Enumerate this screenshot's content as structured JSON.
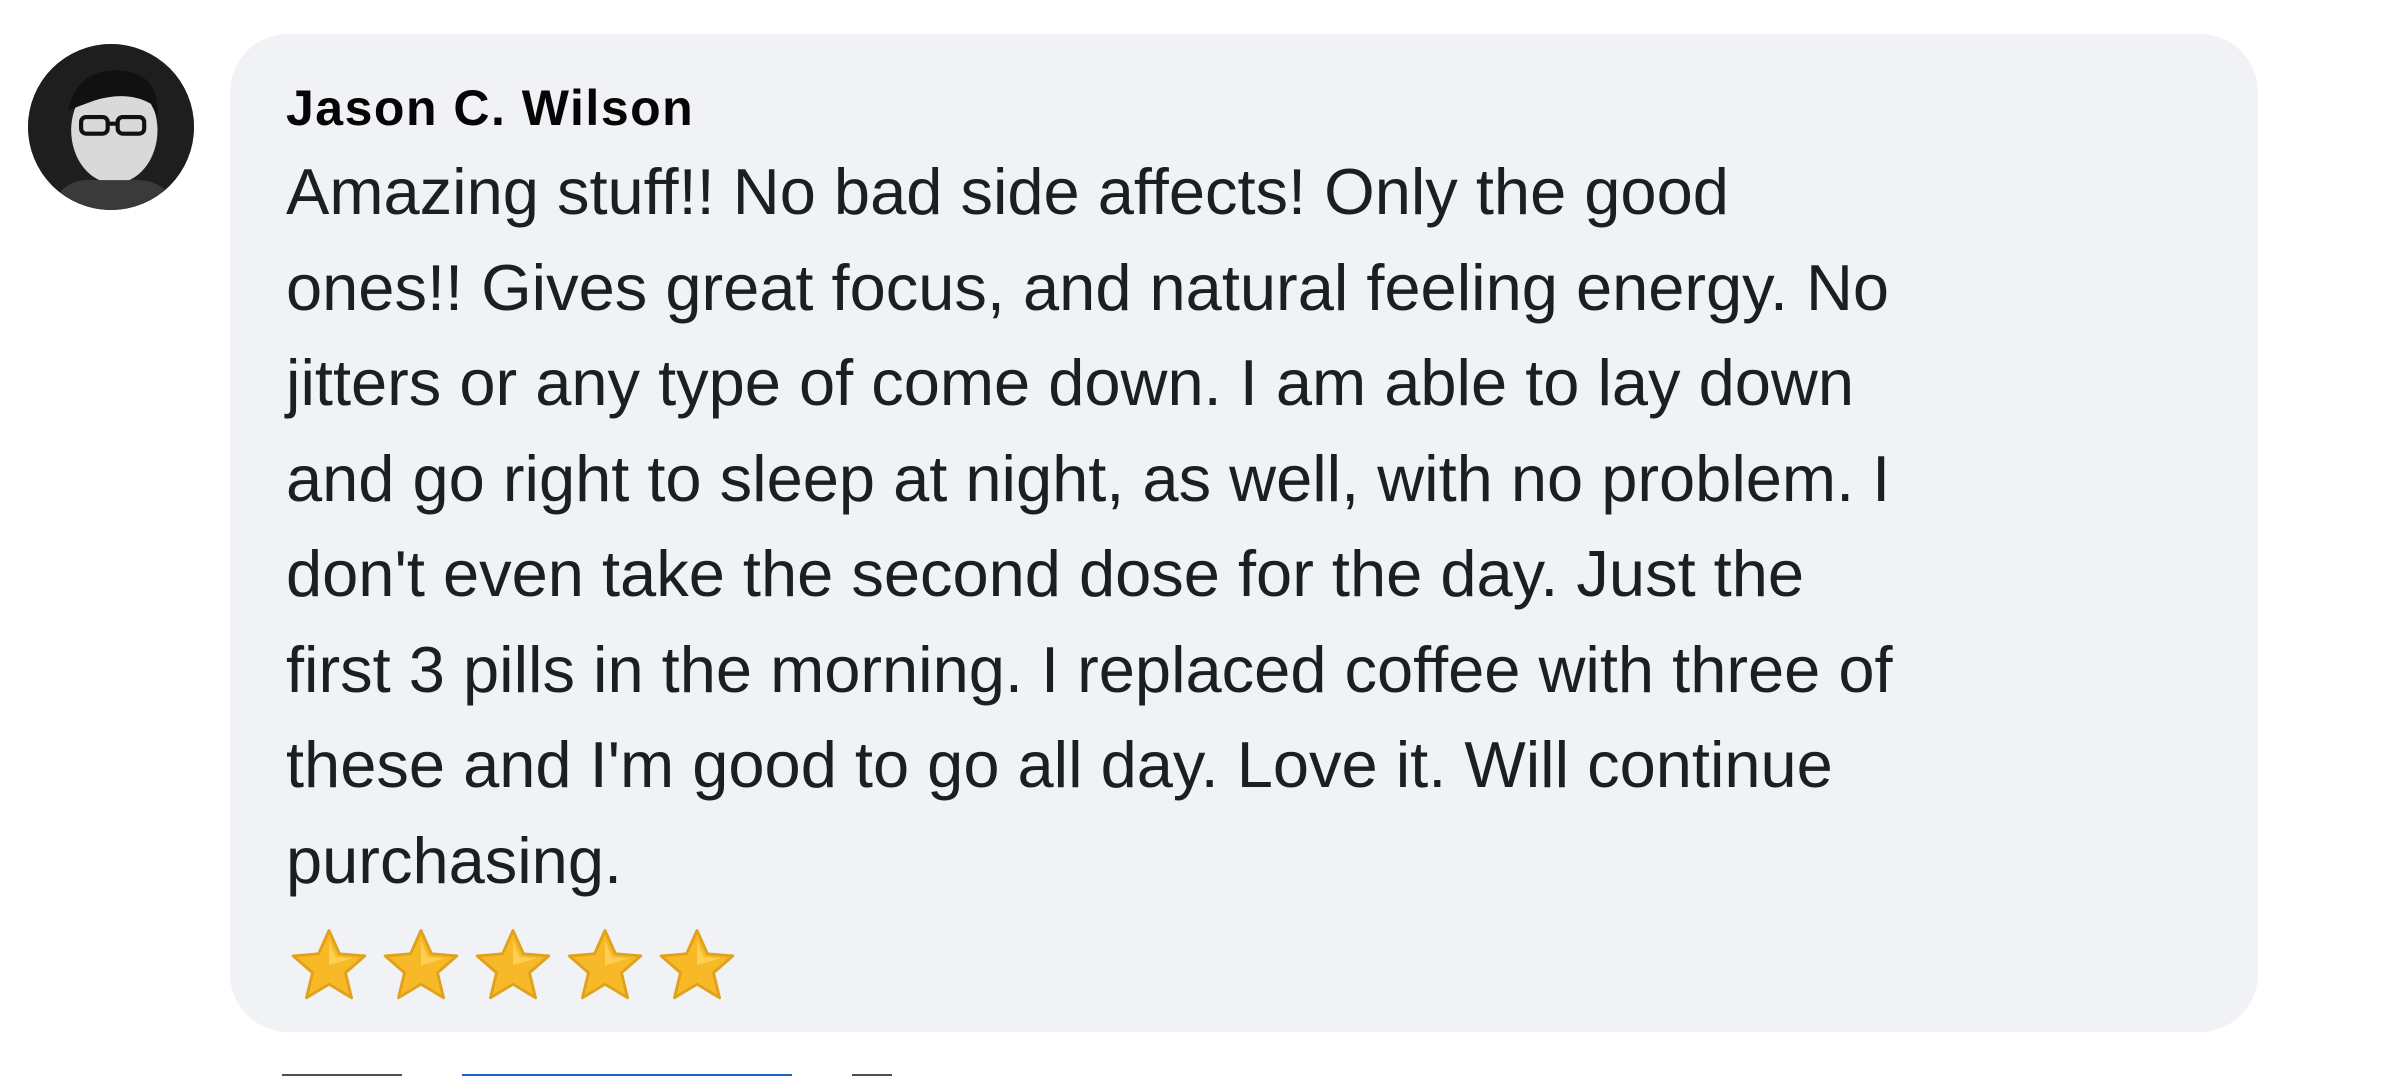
{
  "comment": {
    "author": "Jason C. Wilson",
    "lines": [
      "Amazing stuff!! No bad side affects! Only the good",
      "ones!! Gives great focus, and natural feeling energy. No",
      "jitters or any type of come down. I am able to lay down",
      "and go right to sleep at night, as well, with no problem. I",
      "don't even take the second dose for the day. Just the",
      "first 3 pills in the morning. I replaced coffee with three of",
      "these and I'm good to go all day. Love it. Will continue",
      "purchasing."
    ],
    "rating": {
      "stars": 5,
      "star_icon": "star-emoji-icon",
      "star_color": "#f7b928"
    }
  },
  "colors": {
    "bubble_bg": "#f0f2f5",
    "author": "#050505",
    "text": "#1c1e21"
  }
}
